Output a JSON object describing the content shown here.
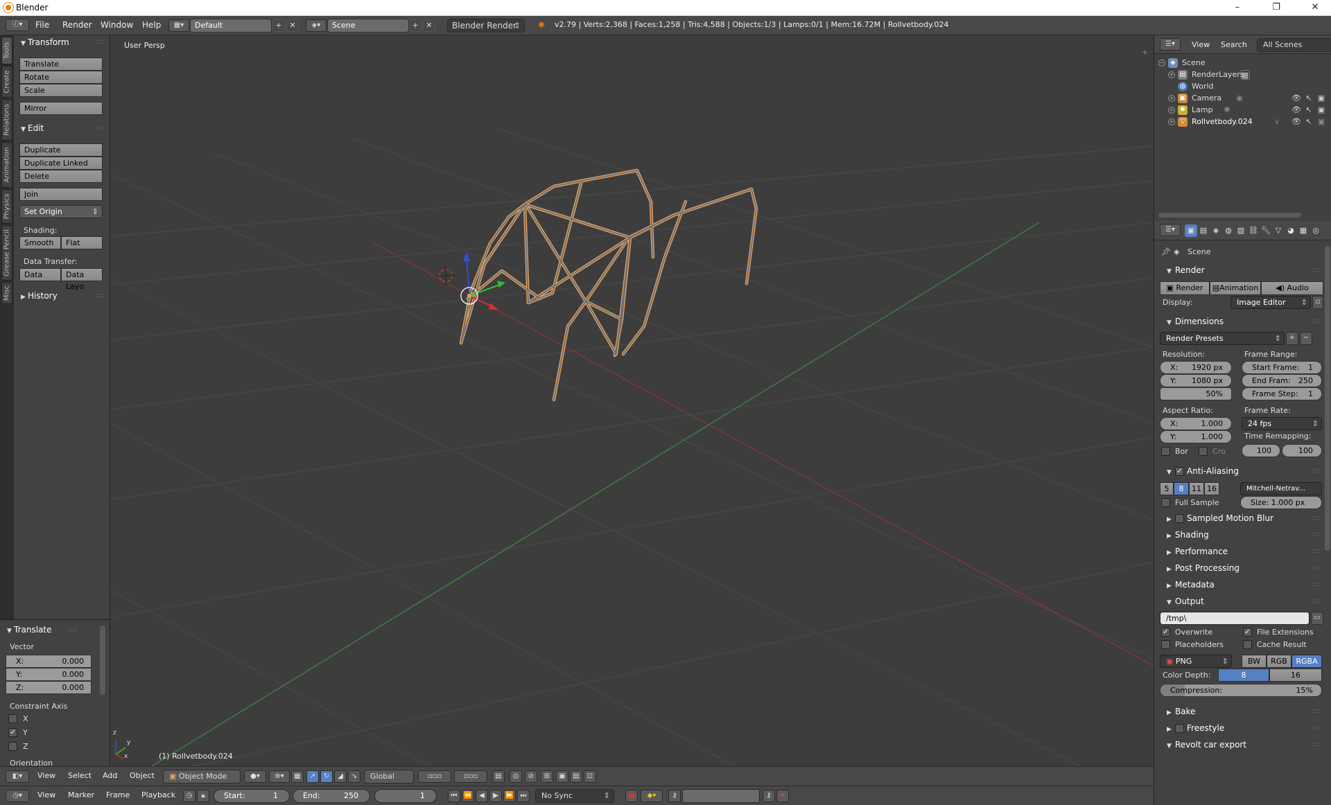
{
  "window": {
    "title": "Blender",
    "minimize": "–",
    "maximize": "❐",
    "close": "✕"
  },
  "info_header": {
    "menus": [
      "File",
      "Render",
      "Window",
      "Help"
    ],
    "layout": "Default",
    "scene": "Scene",
    "engine": "Blender Render",
    "stats": "v2.79 | Verts:2,368 | Faces:1,258 | Tris:4,588 | Objects:1/3 | Lamps:0/1 | Mem:16.72M | Rollvetbody.024"
  },
  "tool_tabs": [
    "Tools",
    "Create",
    "Relations",
    "Animation",
    "Physics",
    "Grease Pencil",
    "Misc"
  ],
  "tool_shelf": {
    "transform": {
      "title": "Transform",
      "buttons": [
        "Translate",
        "Rotate",
        "Scale",
        "Mirror"
      ]
    },
    "edit": {
      "title": "Edit",
      "buttons": [
        "Duplicate",
        "Duplicate Linked",
        "Delete",
        "Join"
      ],
      "set_origin": "Set Origin"
    },
    "shading": {
      "label": "Shading:",
      "smooth": "Smooth",
      "flat": "Flat"
    },
    "data_transfer": {
      "label": "Data Transfer:",
      "data": "Data",
      "data_layo": "Data Layo"
    },
    "history": {
      "title": "History"
    }
  },
  "redo_panel": {
    "title": "Translate",
    "vector_label": "Vector",
    "x": {
      "label": "X:",
      "value": "0.000"
    },
    "y": {
      "label": "Y:",
      "value": "0.000"
    },
    "z": {
      "label": "Z:",
      "value": "0.000"
    },
    "constraint_label": "Constraint Axis",
    "axes": [
      {
        "label": "X",
        "checked": false
      },
      {
        "label": "Y",
        "checked": true
      },
      {
        "label": "Z",
        "checked": false
      }
    ],
    "orientation_label": "Orientation"
  },
  "viewport": {
    "view_label": "User Persp",
    "object_label": "(1) Rollvetbody.024",
    "axis_x": "x",
    "axis_y": "y",
    "axis_z": "z"
  },
  "view3d_header": {
    "menus": [
      "View",
      "Select",
      "Add",
      "Object"
    ],
    "mode": "Object Mode",
    "orientation": "Global"
  },
  "timeline_header": {
    "menus": [
      "View",
      "Marker",
      "Frame",
      "Playback"
    ],
    "start_label": "Start:",
    "start": "1",
    "end_label": "End:",
    "end": "250",
    "current": "1",
    "sync": "No Sync"
  },
  "outliner": {
    "menus": [
      "View",
      "Search"
    ],
    "filter": "All Scenes",
    "rows": [
      {
        "label": "Scene",
        "icon": "scene-icon",
        "color": "#6f8fb8"
      },
      {
        "label": "RenderLayers",
        "icon": "renderlayers-icon",
        "color": "#7a7a7a"
      },
      {
        "label": "World",
        "icon": "world-icon",
        "color": "#4d79b0"
      },
      {
        "label": "Camera",
        "icon": "camera-icon",
        "color": "#c9883a"
      },
      {
        "label": "Lamp",
        "icon": "lamp-icon",
        "color": "#c9b03a"
      },
      {
        "label": "Rollvetbody.024",
        "icon": "mesh-icon",
        "color": "#d4883a"
      }
    ]
  },
  "properties": {
    "context": "Scene",
    "render": {
      "title": "Render",
      "render_btn": "Render",
      "animation_btn": "Animation",
      "audio_btn": "Audio",
      "display_label": "Display:",
      "display_value": "Image Editor"
    },
    "dimensions": {
      "title": "Dimensions",
      "presets": "Render Presets",
      "resolution_label": "Resolution:",
      "res_x_label": "X:",
      "res_x": "1920 px",
      "res_y_label": "Y:",
      "res_y": "1080 px",
      "res_pct": "50%",
      "frame_range_label": "Frame Range:",
      "start_label": "Start Frame:",
      "start": "1",
      "end_label": "End Fram:",
      "end": "250",
      "step_label": "Frame Step:",
      "step": "1",
      "aspect_label": "Aspect Ratio:",
      "asp_x_label": "X:",
      "asp_x": "1.000",
      "asp_y_label": "Y:",
      "asp_y": "1.000",
      "frame_rate_label": "Frame Rate:",
      "frame_rate": "24 fps",
      "time_remap_label": "Time Remapping:",
      "remap_old": "100",
      "remap_new": "100",
      "bor": "Bor",
      "cro": "Cro"
    },
    "antialiasing": {
      "title": "Anti-Aliasing",
      "samples": [
        "5",
        "8",
        "11",
        "16"
      ],
      "selected": "8",
      "filter": "Mitchell-Netrav...",
      "full_sample": "Full Sample",
      "size_label": "Size:",
      "size": "1.000 px"
    },
    "collapsed": [
      "Sampled Motion Blur",
      "Shading",
      "Performance",
      "Post Processing",
      "Metadata"
    ],
    "output": {
      "title": "Output",
      "path": "/tmp\\",
      "overwrite": "Overwrite",
      "file_ext": "File Extensions",
      "placeholders": "Placeholders",
      "cache": "Cache Result",
      "format": "PNG",
      "bw": "BW",
      "rgb": "RGB",
      "rgba": "RGBA",
      "depth_label": "Color Depth:",
      "depth_8": "8",
      "depth_16": "16",
      "compression_label": "Compression:",
      "compression": "15%",
      "compression_fraction": 0.15
    },
    "bottom_sections": [
      "Bake",
      "Freestyle",
      "Revolt car export"
    ]
  },
  "colors": {
    "accent": "#5680c2",
    "select_orange": "#e8a35c",
    "axis_red": "#9e3030",
    "axis_green": "#3f8a3f"
  }
}
